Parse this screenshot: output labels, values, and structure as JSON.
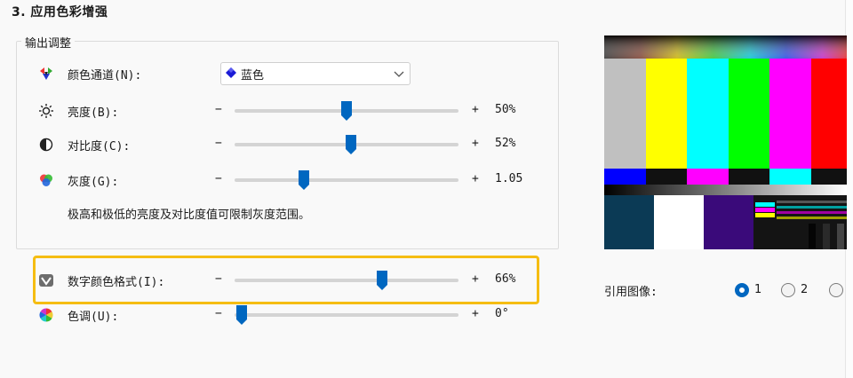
{
  "section": {
    "title": "3. 应用色彩增强"
  },
  "group": {
    "legend": "输出调整"
  },
  "channel": {
    "label": "颜色通道(N):",
    "selected": "蓝色",
    "icon": "color-channel-icon"
  },
  "sliders": [
    {
      "label": "亮度(B):",
      "minus": "−",
      "plus": "+",
      "value_text": "50%",
      "level": 0.5,
      "icon": "brightness-icon"
    },
    {
      "label": "对比度(C):",
      "minus": "−",
      "plus": "+",
      "value_text": "52%",
      "level": 0.52,
      "icon": "contrast-icon"
    },
    {
      "label": "灰度(G):",
      "minus": "−",
      "plus": "+",
      "value_text": "1.05",
      "level": 0.31,
      "icon": "gamma-icon"
    },
    {
      "label": "数字颜色格式(I):",
      "minus": "−",
      "plus": "+",
      "value_text": "66%",
      "level": 0.66,
      "icon": "digital-color-icon"
    },
    {
      "label": "色调(U):",
      "minus": "−",
      "plus": "+",
      "value_text": "0°",
      "level": 0.03,
      "icon": "hue-icon"
    }
  ],
  "note": "极高和极低的亮度及对比度值可限制灰度范围。",
  "reference": {
    "label": "引用图像:",
    "options": [
      {
        "label": "1",
        "selected": true
      },
      {
        "label": "2",
        "selected": false
      },
      {
        "label": "",
        "selected": false
      }
    ]
  },
  "colors": {
    "accent": "#0067c0",
    "highlight": "#f5bd12",
    "channel_icon": "#1b1bd6"
  }
}
